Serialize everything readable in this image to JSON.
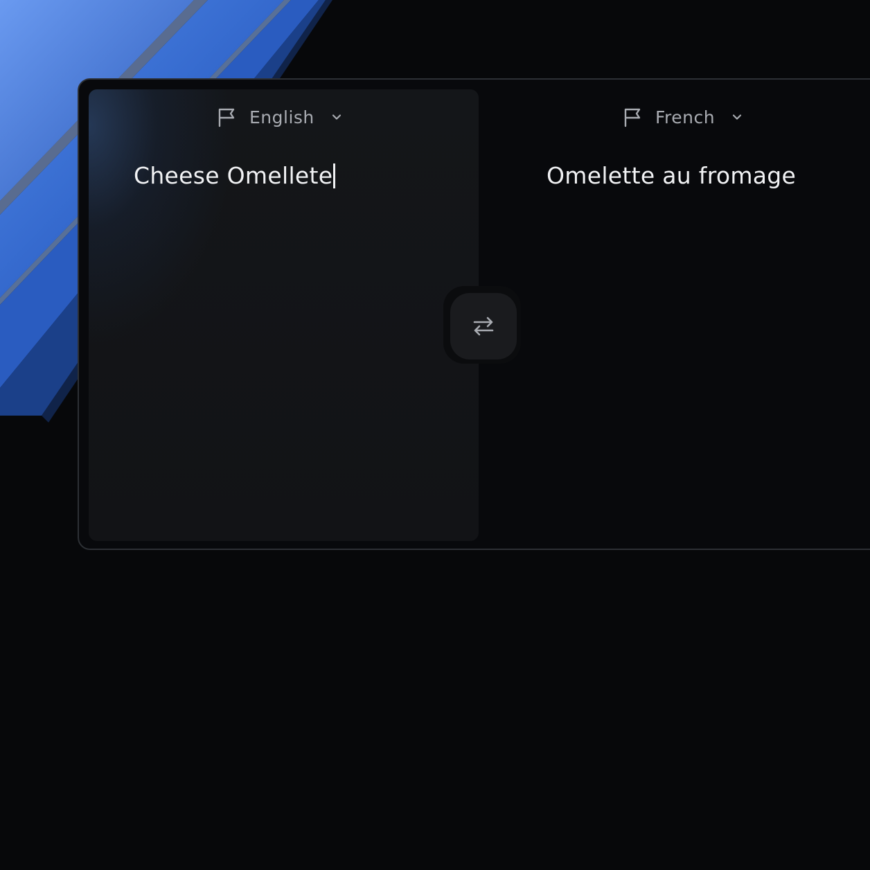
{
  "source": {
    "language": "English",
    "text": "Cheese Omellete",
    "flag_icon": "flag-icon",
    "dropdown_icon": "chevron-down-icon"
  },
  "target": {
    "language": "French",
    "text": "Omelette au fromage",
    "flag_icon": "flag-icon",
    "dropdown_icon": "chevron-down-icon"
  },
  "swap": {
    "icon": "swap-arrows-icon"
  },
  "colors": {
    "background": "#07080a",
    "accent_blue": "#3a6ed0",
    "text_primary": "#f1f2f4",
    "text_secondary": "#a9acb2",
    "panel": "#141619",
    "border": "#2d3035"
  }
}
